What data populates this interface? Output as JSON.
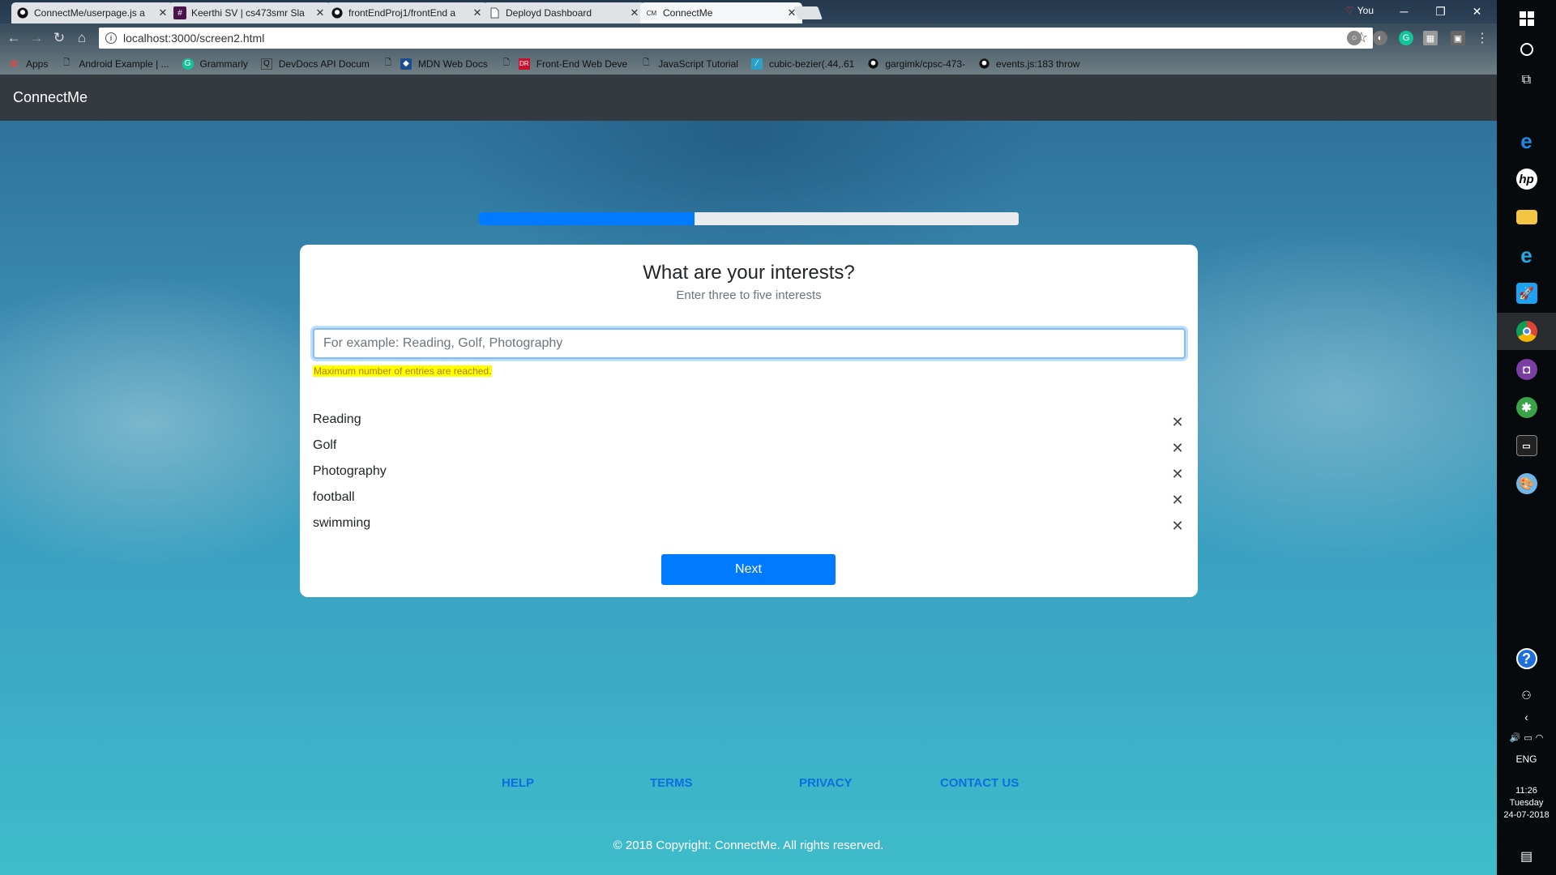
{
  "browser": {
    "tabs": [
      {
        "title": "ConnectMe/userpage.js a",
        "icon": "github-icon"
      },
      {
        "title": "Keerthi SV | cs473smr Sla",
        "icon": "slack-icon"
      },
      {
        "title": "frontEndProj1/frontEnd a",
        "icon": "github-icon"
      },
      {
        "title": "Deployd Dashboard",
        "icon": "page-icon"
      },
      {
        "title": "ConnectMe",
        "icon": "cm-icon",
        "active": true,
        "favicon_text": "CM"
      }
    ],
    "profile_name": "You",
    "url": "localhost:3000/screen2.html",
    "bookmarks": [
      {
        "label": "Apps",
        "icon": "apps-grid-icon"
      },
      {
        "label": "Android Example | ...",
        "icon": "page-icon"
      },
      {
        "label": "Grammarly",
        "icon": "grammarly-icon"
      },
      {
        "label": "DevDocs API Docum",
        "icon": "devdocs-icon"
      },
      {
        "label": "MDN Web Docs",
        "icon": "mdn-icon"
      },
      {
        "label": "Front-End Web Deve",
        "icon": "dr-icon"
      },
      {
        "label": "JavaScript Tutorial",
        "icon": "page-icon"
      },
      {
        "label": "cubic-bezier(.44,.61",
        "icon": "bezier-icon"
      },
      {
        "label": "gargimk/cpsc-473-",
        "icon": "github-icon"
      },
      {
        "label": "events.js:183 throw",
        "icon": "github-icon"
      }
    ]
  },
  "app": {
    "brand": "ConnectMe",
    "progress_percent": 40,
    "card": {
      "title": "What are your interests?",
      "subtitle": "Enter three to five interests",
      "input_placeholder": "For example: Reading, Golf, Photography",
      "input_value": "",
      "warning": "Maximum number of entries are reached.",
      "interests": [
        "Reading",
        "Golf",
        "Photography",
        "football",
        "swimming"
      ],
      "remove_symbol": "✕",
      "next_label": "Next"
    },
    "footer": {
      "links": [
        "HELP",
        "TERMS",
        "PRIVACY",
        "CONTACT US"
      ],
      "copyright": "© 2018 Copyright: ConnectMe. All rights reserved."
    }
  },
  "taskbar": {
    "apps": [
      "edge-icon",
      "hp-icon",
      "file-explorer-icon",
      "internet-explorer-icon",
      "rocket-icon",
      "chrome-icon",
      "app-purple-icon",
      "app-green-icon",
      "terminal-icon",
      "paint-icon"
    ],
    "language": "ENG",
    "time": "11:26",
    "day": "Tuesday",
    "date": "24-07-2018"
  },
  "colors": {
    "primary": "#007bff",
    "navbar": "#343a40",
    "warning_highlight": "#ffff00"
  }
}
